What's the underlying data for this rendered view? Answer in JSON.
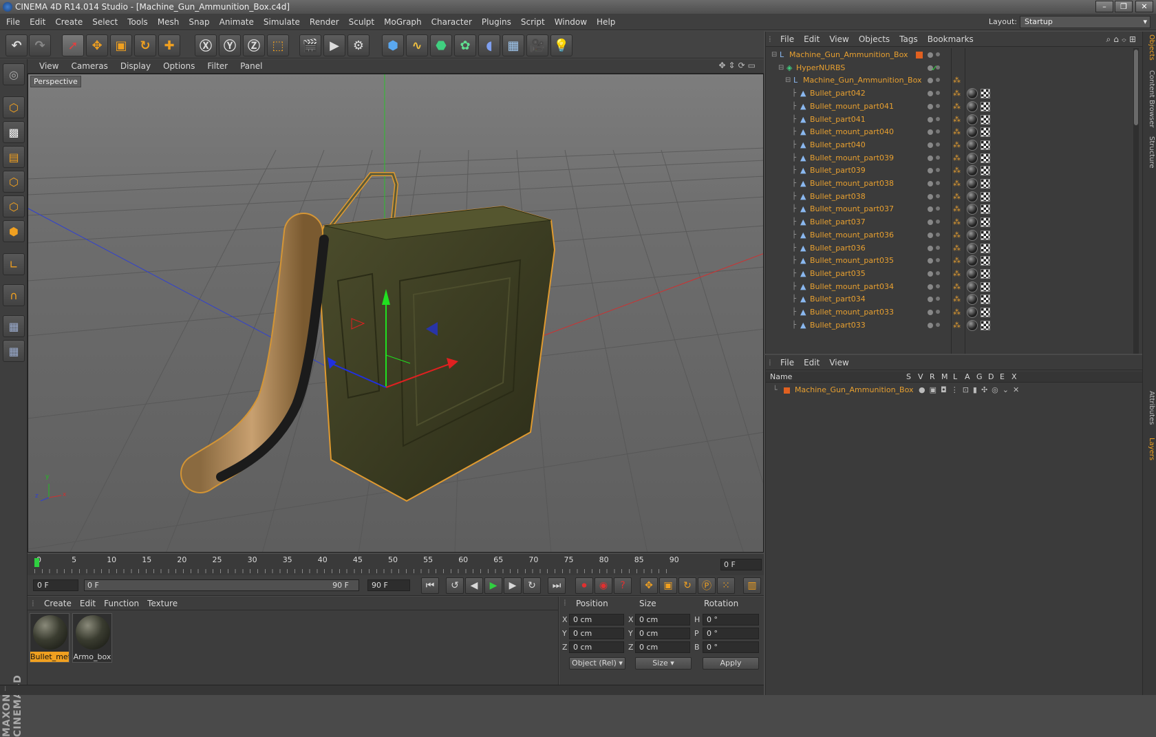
{
  "window": {
    "title": "CINEMA 4D R14.014 Studio - [Machine_Gun_Ammunition_Box.c4d]"
  },
  "menubar": {
    "items": [
      "File",
      "Edit",
      "Create",
      "Select",
      "Tools",
      "Mesh",
      "Snap",
      "Animate",
      "Simulate",
      "Render",
      "Sculpt",
      "MoGraph",
      "Character",
      "Plugins",
      "Script",
      "Window",
      "Help"
    ],
    "layout_label": "Layout:",
    "layout_value": "Startup"
  },
  "viewport": {
    "menu": [
      "View",
      "Cameras",
      "Display",
      "Options",
      "Filter",
      "Panel"
    ],
    "label": "Perspective"
  },
  "timeline": {
    "ticks": [
      "0",
      "5",
      "10",
      "15",
      "20",
      "25",
      "30",
      "35",
      "40",
      "45",
      "50",
      "55",
      "60",
      "65",
      "70",
      "75",
      "80",
      "85",
      "90"
    ],
    "current_frame": "0 F"
  },
  "transport": {
    "start_field": "0 F",
    "range_left": "0 F",
    "range_right": "90 F",
    "end_field": "90 F"
  },
  "materials": {
    "menu": [
      "Create",
      "Edit",
      "Function",
      "Texture"
    ],
    "items": [
      {
        "label": "Bullet_met",
        "selected": true
      },
      {
        "label": "Armo_box",
        "selected": false
      }
    ]
  },
  "coords": {
    "headers": [
      "Position",
      "Size",
      "Rotation"
    ],
    "rows": [
      {
        "axis": "X",
        "pos": "0 cm",
        "size_axis": "X",
        "size": "0 cm",
        "rot_axis": "H",
        "rot": "0 °"
      },
      {
        "axis": "Y",
        "pos": "0 cm",
        "size_axis": "Y",
        "size": "0 cm",
        "rot_axis": "P",
        "rot": "0 °"
      },
      {
        "axis": "Z",
        "pos": "0 cm",
        "size_axis": "Z",
        "size": "0 cm",
        "rot_axis": "B",
        "rot": "0 °"
      }
    ],
    "mode_select": "Object (Rel)",
    "size_select": "Size",
    "apply": "Apply"
  },
  "objects": {
    "menu": [
      "File",
      "Edit",
      "View",
      "Objects",
      "Tags",
      "Bookmarks"
    ],
    "tree": [
      {
        "name": "Machine_Gun_Ammunition_Box",
        "level": 0,
        "tags": false
      },
      {
        "name": "HyperNURBS",
        "level": 1,
        "tags": false
      },
      {
        "name": "Machine_Gun_Ammunition_Box",
        "level": 2,
        "tags": false
      },
      {
        "name": "Bullet_part042",
        "level": 3,
        "tags": true
      },
      {
        "name": "Bullet_mount_part041",
        "level": 3,
        "tags": true
      },
      {
        "name": "Bullet_part041",
        "level": 3,
        "tags": true
      },
      {
        "name": "Bullet_mount_part040",
        "level": 3,
        "tags": true
      },
      {
        "name": "Bullet_part040",
        "level": 3,
        "tags": true
      },
      {
        "name": "Bullet_mount_part039",
        "level": 3,
        "tags": true
      },
      {
        "name": "Bullet_part039",
        "level": 3,
        "tags": true
      },
      {
        "name": "Bullet_mount_part038",
        "level": 3,
        "tags": true
      },
      {
        "name": "Bullet_part038",
        "level": 3,
        "tags": true
      },
      {
        "name": "Bullet_mount_part037",
        "level": 3,
        "tags": true
      },
      {
        "name": "Bullet_part037",
        "level": 3,
        "tags": true
      },
      {
        "name": "Bullet_mount_part036",
        "level": 3,
        "tags": true
      },
      {
        "name": "Bullet_part036",
        "level": 3,
        "tags": true
      },
      {
        "name": "Bullet_mount_part035",
        "level": 3,
        "tags": true
      },
      {
        "name": "Bullet_part035",
        "level": 3,
        "tags": true
      },
      {
        "name": "Bullet_mount_part034",
        "level": 3,
        "tags": true
      },
      {
        "name": "Bullet_part034",
        "level": 3,
        "tags": true
      },
      {
        "name": "Bullet_mount_part033",
        "level": 3,
        "tags": true
      },
      {
        "name": "Bullet_part033",
        "level": 3,
        "tags": true
      }
    ]
  },
  "layers": {
    "menu": [
      "File",
      "Edit",
      "View"
    ],
    "columns": [
      "Name",
      "S",
      "V",
      "R",
      "M",
      "L",
      "A",
      "G",
      "D",
      "E",
      "X"
    ],
    "rows": [
      {
        "name": "Machine_Gun_Ammunition_Box"
      }
    ]
  },
  "side_tabs": [
    "Objects",
    "Content Browser",
    "Structure",
    "Attributes",
    "Layers"
  ],
  "colors": {
    "accent": "#e8a030",
    "selection": "#f0a020"
  }
}
